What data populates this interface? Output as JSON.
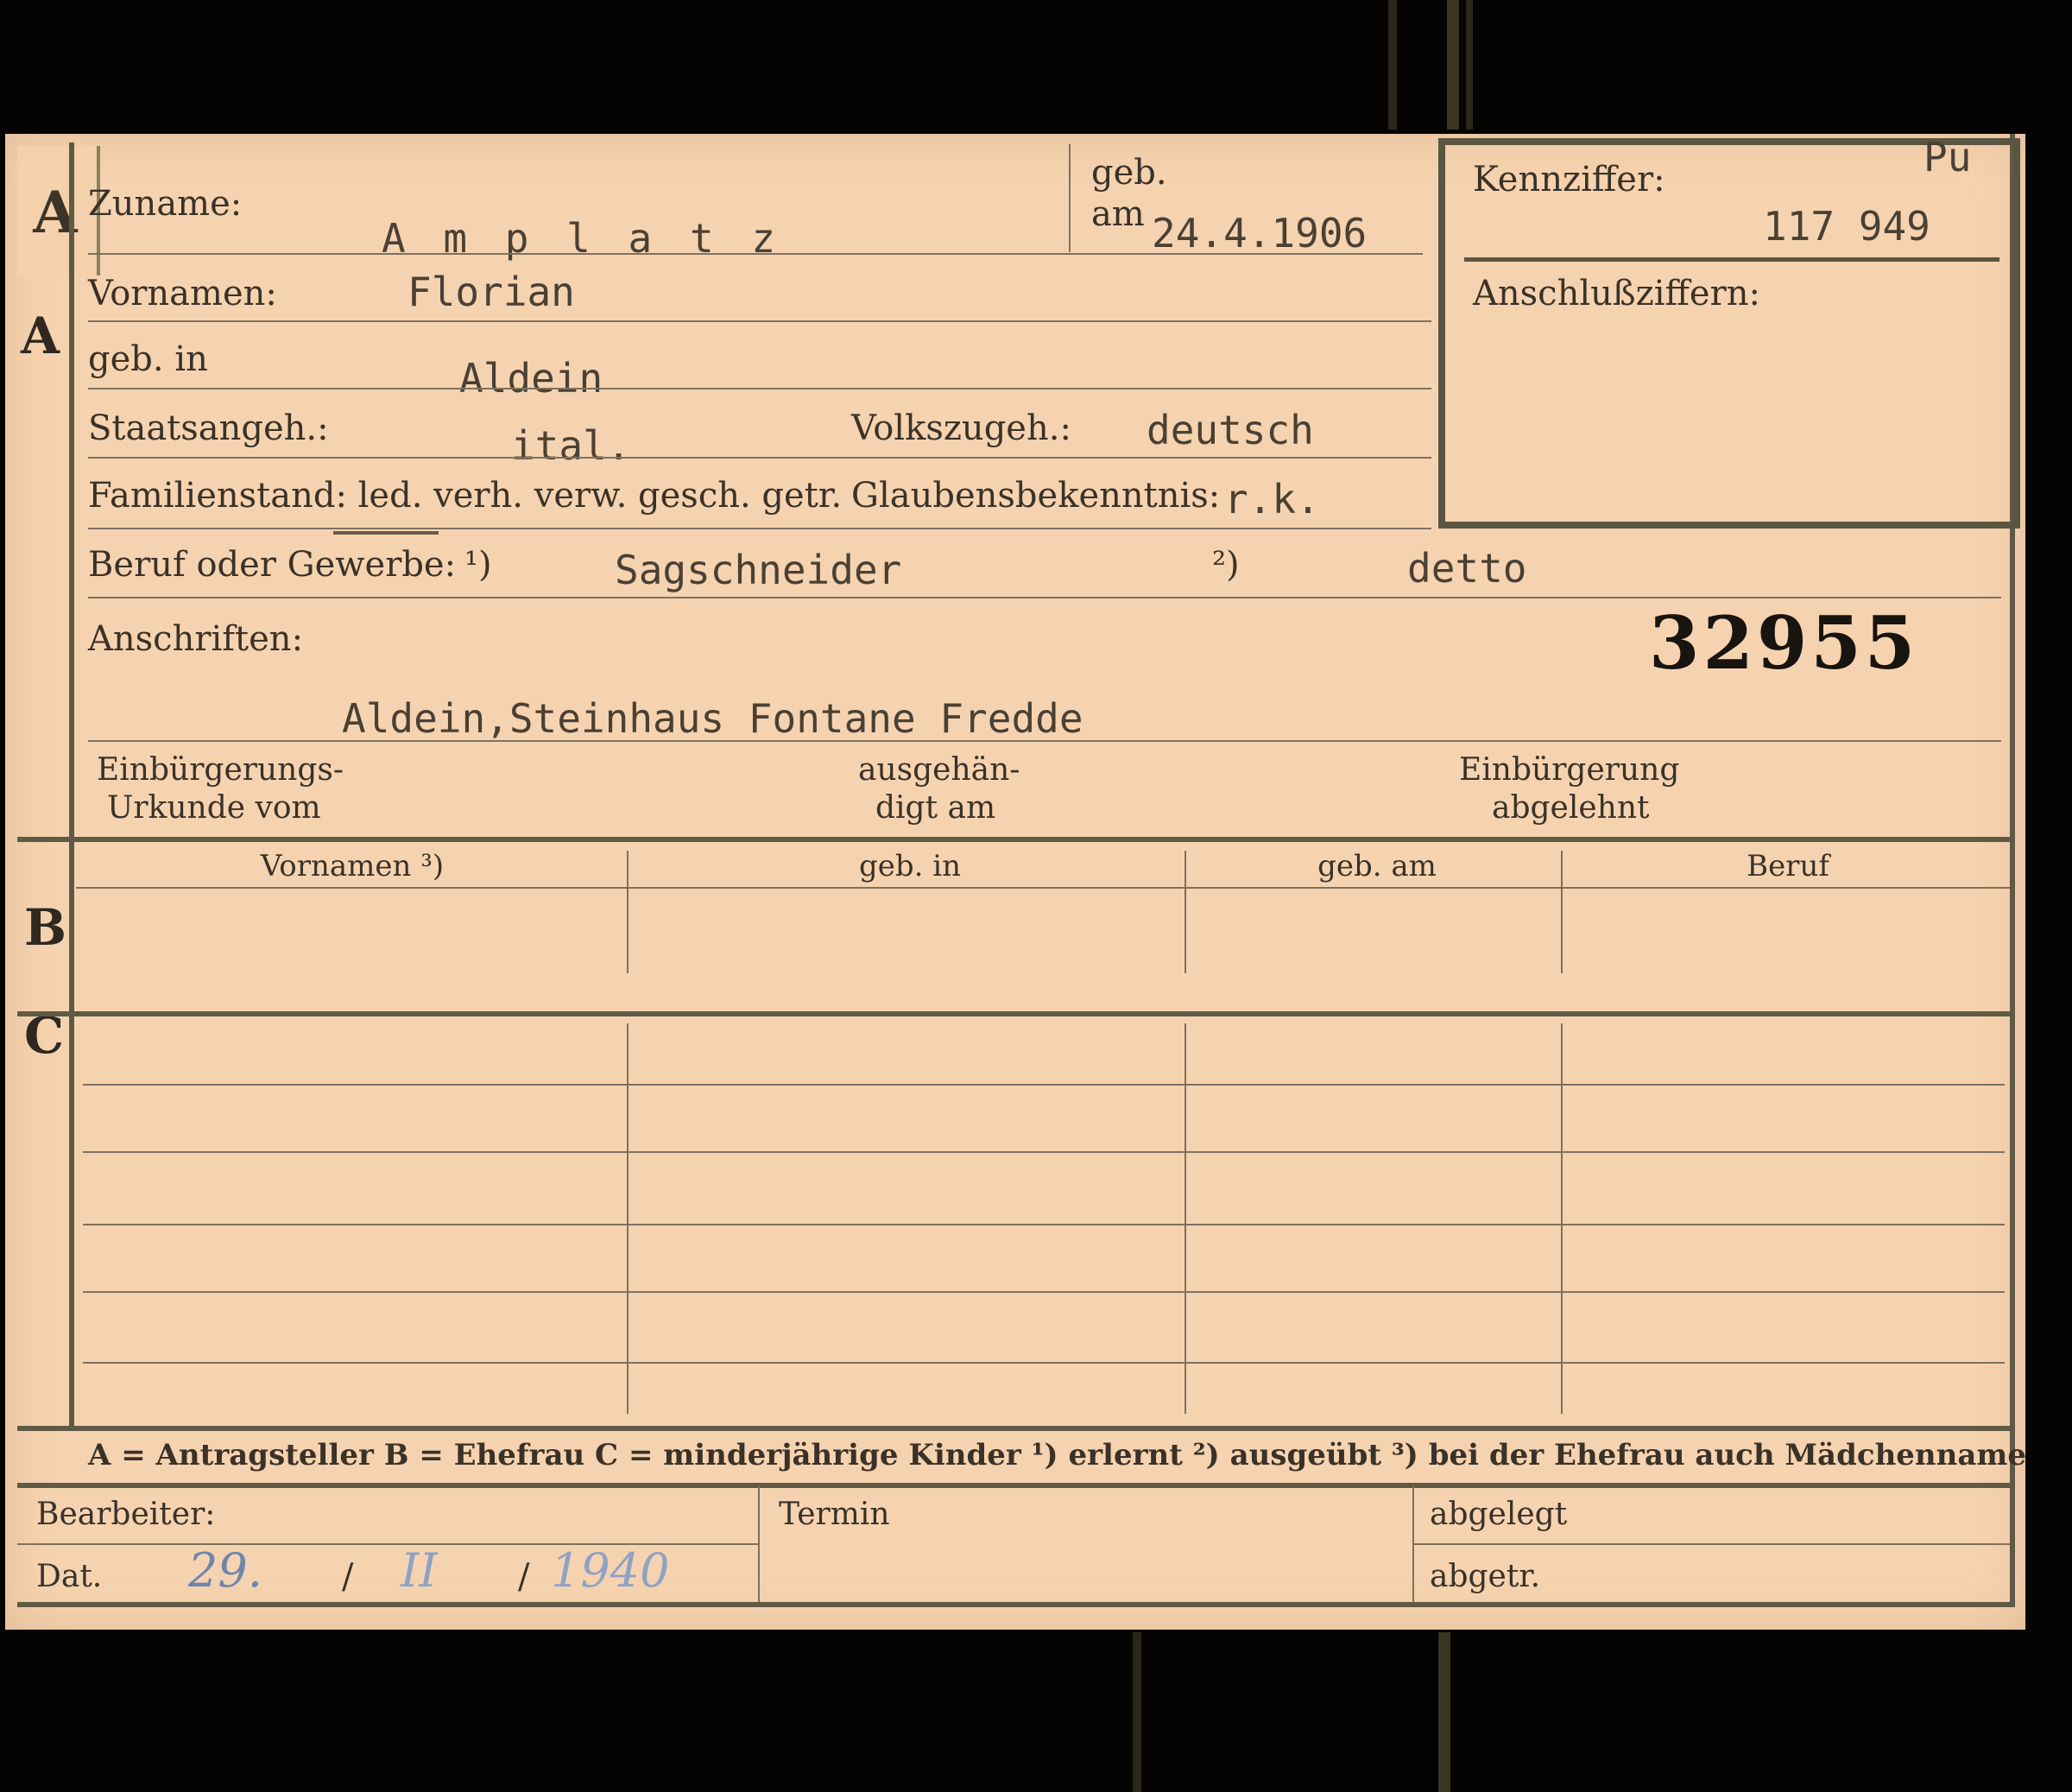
{
  "tab": {
    "letter": "A"
  },
  "sections": {
    "a": "A",
    "b": "B",
    "c": "C"
  },
  "labels": {
    "zuname": "Zuname:",
    "geb": "geb.",
    "am": "am",
    "kennziffer": "Kennziffer:",
    "anschlussziffern": "Anschlußziffern:",
    "vornamen": "Vornamen:",
    "geb_in": "geb. in",
    "staatsangeh": "Staatsangeh.:",
    "volkszugeh": "Volkszugeh.:",
    "familienstand": "Familienstand: led. verh. verw. gesch. getr.",
    "glaubensbekenntnis": "Glaubensbekenntnis:",
    "beruf": "Beruf oder Gewerbe:",
    "beruf_note1": "¹)",
    "beruf_note2": "²)",
    "anschriften": "Anschriften:",
    "einbuergerung_1": "Einbürgerungs-",
    "einbuergerung_2": "Urkunde vom",
    "ausgehaendigt_1": "ausgehän-",
    "ausgehaendigt_2": "digt am",
    "abgelehnt_1": "Einbürgerung",
    "abgelehnt_2": "abgelehnt"
  },
  "values": {
    "zuname": "A m p l a t z",
    "geb_am": "24.4.1906",
    "kennziffer_prefix": "Pu",
    "kennziffer": "117 949",
    "vornamen": "Florian",
    "geb_in": "Aldein",
    "staatsangeh": "ital.",
    "volkszugeh": "deutsch",
    "glaubensbekenntnis": "r.k.",
    "beruf_erlernt": "Sagschneider",
    "beruf_ausgeuebt": "detto",
    "anschrift": "Aldein,Steinhaus Fontane Fredde",
    "stamp_number": "32955"
  },
  "table_b": {
    "headers": [
      "Vornamen ³)",
      "geb. in",
      "geb. am",
      "Beruf"
    ]
  },
  "legend": "A = Antragsteller   B = Ehefrau   C = minderjährige Kinder   ¹) erlernt   ²) ausgeübt   ³) bei der Ehefrau auch Mädchenname",
  "footer": {
    "bearbeiter": "Bearbeiter:",
    "dat": "Dat.",
    "dat_day": "29.",
    "dat_month": "II",
    "dat_year": "1940",
    "sep": "/",
    "termin": "Termin",
    "abgelegt": "abgelegt",
    "abgetr": "abgetr."
  }
}
